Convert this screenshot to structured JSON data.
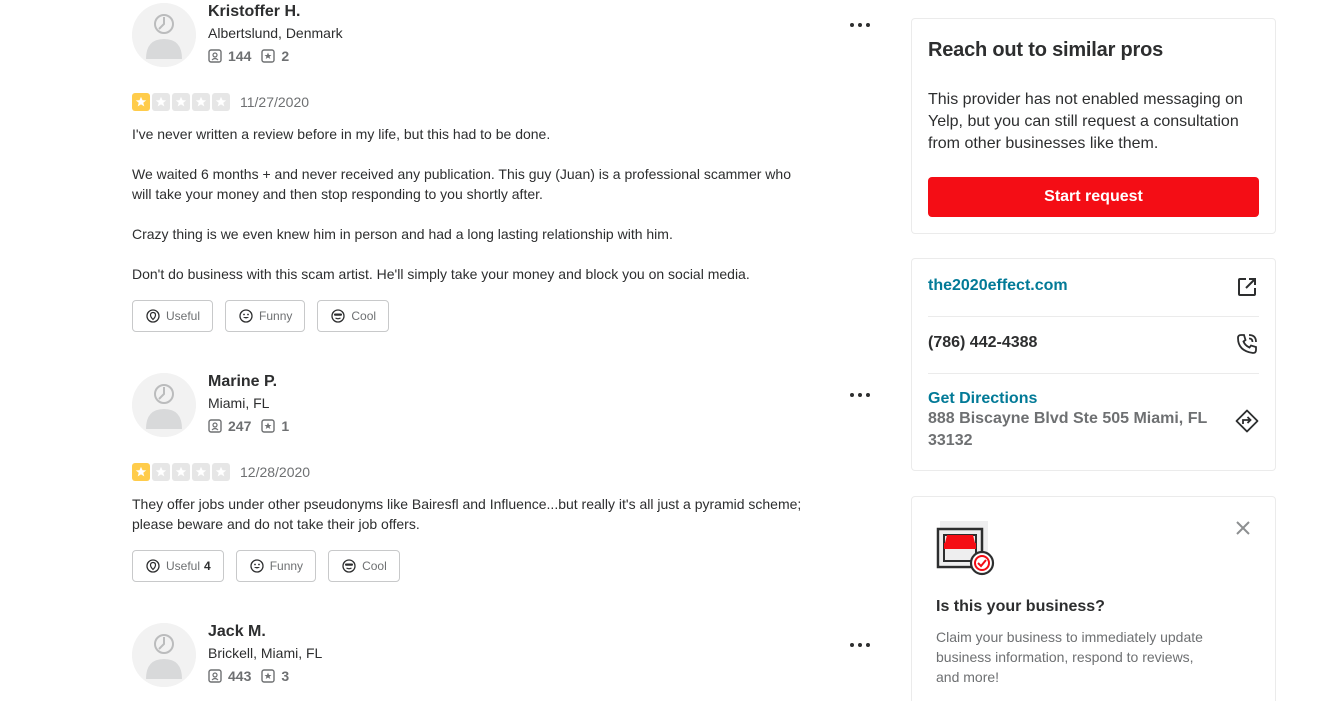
{
  "reviews": [
    {
      "name": "Kristoffer H.",
      "location": "Albertslund, Denmark",
      "friends": "144",
      "review_count": "2",
      "rating": 1,
      "date": "11/27/2020",
      "paragraphs": [
        "I've never written a review before in my life, but this had to be done.",
        "We waited 6 months + and never received any publication. This guy (Juan) is a professional scammer who will take your money and then stop responding to you shortly after.",
        "Crazy thing is we even knew him in person and had a long lasting relationship with him.",
        "Don't do business with this scam artist. He'll simply take your money and block you on social media."
      ],
      "useful_label": "Useful",
      "useful_count": "",
      "funny_label": "Funny",
      "cool_label": "Cool"
    },
    {
      "name": "Marine P.",
      "location": "Miami, FL",
      "friends": "247",
      "review_count": "1",
      "rating": 1,
      "date": "12/28/2020",
      "paragraphs": [
        "They offer jobs under other pseudonyms like Bairesfl and Influence...but really it's all just a pyramid scheme; please beware and do not take their job offers."
      ],
      "useful_label": "Useful",
      "useful_count": "4",
      "funny_label": "Funny",
      "cool_label": "Cool"
    },
    {
      "name": "Jack M.",
      "location": "Brickell, Miami, FL",
      "friends": "443",
      "review_count": "3"
    }
  ],
  "sidebar": {
    "reach_title": "Reach out to similar pros",
    "reach_desc": "This provider has not enabled messaging on Yelp, but you can still request a consultation from other businesses like them.",
    "start_request": "Start request",
    "website": "the2020effect.com",
    "phone": "(786) 442-4388",
    "directions_label": "Get Directions",
    "address": "888 Biscayne Blvd Ste 505 Miami, FL 33132",
    "claim_title": "Is this your business?",
    "claim_desc": "Claim your business to immediately update business information, respond to reviews, and more!"
  },
  "colors": {
    "brand_red": "#f40d15",
    "link_teal": "#027a97",
    "star_yellow": "#ffcc4b"
  },
  "icons": [
    "user-avatar-icon",
    "friends-icon",
    "reviews-icon",
    "more-options-icon",
    "star-icon",
    "useful-icon",
    "funny-icon",
    "cool-icon",
    "external-link-icon",
    "phone-icon",
    "directions-icon",
    "business-claim-icon",
    "close-icon"
  ]
}
